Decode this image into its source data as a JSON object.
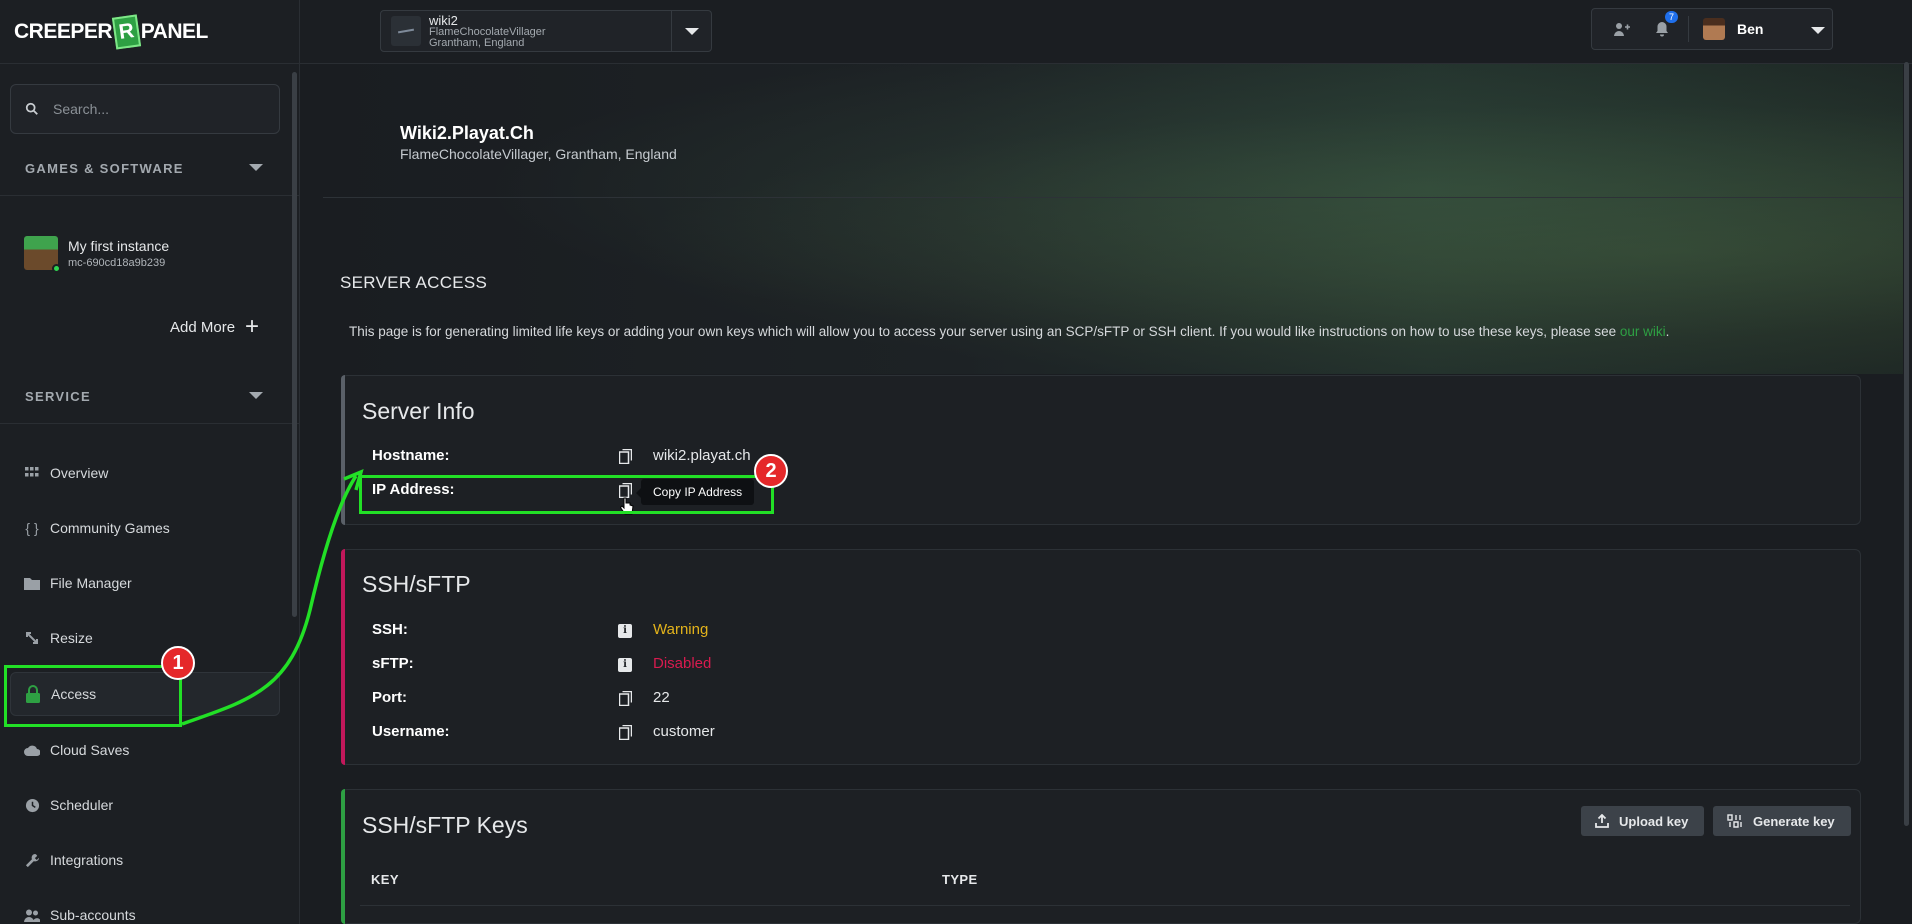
{
  "sidebar": {
    "logo": {
      "left": "CREEPER",
      "mid": "R",
      "right": "PANEL"
    },
    "search_placeholder": "Search...",
    "games_heading": "GAMES & SOFTWARE",
    "instance": {
      "name": "My first instance",
      "id": "mc-690cd18a9b239"
    },
    "add_more": "Add More",
    "service_heading": "SERVICE",
    "items": [
      {
        "label": "Overview",
        "icon": "grid-icon"
      },
      {
        "label": "Community Games",
        "icon": "braces-icon"
      },
      {
        "label": "File Manager",
        "icon": "folder-icon"
      },
      {
        "label": "Resize",
        "icon": "resize-icon"
      },
      {
        "label": "Access",
        "icon": "lock-icon",
        "active": true
      },
      {
        "label": "Cloud Saves",
        "icon": "cloud-icon"
      },
      {
        "label": "Scheduler",
        "icon": "clock-icon"
      },
      {
        "label": "Integrations",
        "icon": "wrench-icon"
      },
      {
        "label": "Sub-accounts",
        "icon": "users-icon"
      }
    ]
  },
  "topbar": {
    "server_name": "wiki2",
    "server_sub1": "FlameChocolateVillager",
    "server_sub2": "Grantham, England",
    "notifications_count": "7",
    "user_name": "Ben"
  },
  "header": {
    "title": "Wiki2.Playat.Ch",
    "subtitle": "FlameChocolateVillager, Grantham, England"
  },
  "page": {
    "heading": "SERVER ACCESS",
    "intro": "This page is for generating limited life keys or adding your own keys which will allow you to access your server using an SCP/sFTP or SSH client. If you would like instructions on how to use these keys, please see ",
    "intro_link": "our wiki",
    "intro_end": "."
  },
  "server_info": {
    "title": "Server Info",
    "hostname_label": "Hostname:",
    "hostname_value": "wiki2.playat.ch",
    "ip_label": "IP Address:",
    "tooltip": "Copy IP Address"
  },
  "ssh": {
    "title": "SSH/sFTP",
    "rows": [
      {
        "label": "SSH:",
        "value": "Warning",
        "color": "#e3b31b",
        "icon": "info-icon"
      },
      {
        "label": "sFTP:",
        "value": "Disabled",
        "color": "#d81b4f",
        "icon": "info-icon"
      },
      {
        "label": "Port:",
        "value": "22",
        "color": "#e6e8ea",
        "icon": "copy-icon"
      },
      {
        "label": "Username:",
        "value": "customer",
        "color": "#e6e8ea",
        "icon": "copy-icon"
      }
    ]
  },
  "keys": {
    "title": "SSH/sFTP Keys",
    "upload_label": "Upload key",
    "generate_label": "Generate key",
    "col_key": "KEY",
    "col_type": "TYPE"
  },
  "annotations": {
    "step1": "1",
    "step2": "2"
  },
  "colors": {
    "accent_green": "#2ea043",
    "annotation_green": "#22e026",
    "badge_red": "#e5282a",
    "ssh_accent": "#c2185b"
  }
}
